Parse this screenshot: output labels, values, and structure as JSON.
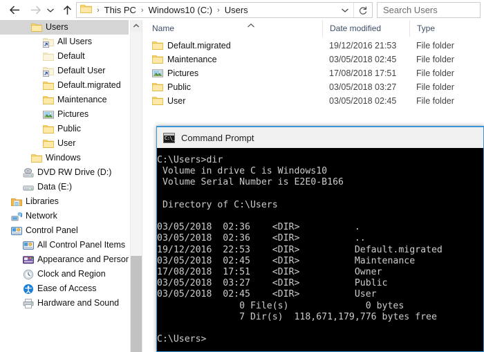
{
  "window": {
    "title": "This PC > Windows10 (C:) > Users"
  },
  "nav": {
    "back_label": "Back",
    "forward_label": "Forward",
    "recent_label": "Recent locations",
    "up_label": "Up one level",
    "breadcrumbs": [
      "This PC",
      "Windows10 (C:)",
      "Users"
    ],
    "separator": "›",
    "dropdown_label": "Previous locations",
    "refresh_label": "Refresh"
  },
  "search": {
    "placeholder": "Search Users"
  },
  "columns": [
    {
      "label": "Name",
      "sorted": true,
      "sort_direction": "ascending"
    },
    {
      "label": "Date modified",
      "sorted": false
    },
    {
      "label": "Type",
      "sorted": false
    }
  ],
  "files": [
    {
      "name": "Default.migrated",
      "date": "19/12/2016 21:53",
      "type": "File folder",
      "icon": "folder-icon"
    },
    {
      "name": "Maintenance",
      "date": "03/05/2018 02:45",
      "type": "File folder",
      "icon": "folder-icon"
    },
    {
      "name": "Pictures",
      "date": "17/08/2018 17:51",
      "type": "File folder",
      "icon": "pictures-folder-icon"
    },
    {
      "name": "Public",
      "date": "03/05/2018 03:27",
      "type": "File folder",
      "icon": "folder-icon"
    },
    {
      "name": "User",
      "date": "03/05/2018 02:45",
      "type": "File folder",
      "icon": "folder-icon"
    }
  ],
  "sidebar": {
    "items": [
      {
        "label": "Users",
        "icon": "folder-icon",
        "indent": 45,
        "selected": true
      },
      {
        "label": "All Users",
        "icon": "shortcut-folder-icon",
        "indent": 62,
        "selected": false
      },
      {
        "label": "Default",
        "icon": "faded-folder-icon",
        "indent": 62,
        "selected": false
      },
      {
        "label": "Default User",
        "icon": "shortcut-folder-icon",
        "indent": 62,
        "selected": false
      },
      {
        "label": "Default.migrated",
        "icon": "folder-icon",
        "indent": 62,
        "selected": false
      },
      {
        "label": "Maintenance",
        "icon": "folder-icon",
        "indent": 62,
        "selected": false
      },
      {
        "label": "Pictures",
        "icon": "pictures-folder-icon",
        "indent": 62,
        "selected": false
      },
      {
        "label": "Public",
        "icon": "folder-icon",
        "indent": 62,
        "selected": false
      },
      {
        "label": "User",
        "icon": "folder-icon",
        "indent": 62,
        "selected": false
      },
      {
        "label": "Windows",
        "icon": "folder-icon",
        "indent": 45,
        "selected": false
      },
      {
        "label": "DVD RW Drive (D:)",
        "icon": "dvd-drive-icon",
        "indent": 33,
        "selected": false
      },
      {
        "label": "Data (E:)",
        "icon": "hard-drive-icon",
        "indent": 33,
        "selected": false
      },
      {
        "label": "Libraries",
        "icon": "libraries-icon",
        "indent": 16,
        "selected": false
      },
      {
        "label": "Network",
        "icon": "network-icon",
        "indent": 16,
        "selected": false
      },
      {
        "label": "Control Panel",
        "icon": "control-panel-icon",
        "indent": 16,
        "selected": false
      },
      {
        "label": "All Control Panel Items",
        "icon": "control-panel-icon",
        "indent": 33,
        "selected": false
      },
      {
        "label": "Appearance and Personalization",
        "icon": "appearance-icon",
        "indent": 33,
        "selected": false
      },
      {
        "label": "Clock and Region",
        "icon": "clock-icon",
        "indent": 33,
        "selected": false
      },
      {
        "label": "Ease of Access",
        "icon": "ease-of-access-icon",
        "indent": 33,
        "selected": false
      },
      {
        "label": "Hardware and Sound",
        "icon": "printer-icon",
        "indent": 33,
        "selected": false
      }
    ]
  },
  "command_prompt": {
    "title": "Command Prompt",
    "icon": "console-icon",
    "console_text": "C:\\Users>dir\n Volume in drive C is Windows10\n Volume Serial Number is E2E0-B166\n\n Directory of C:\\Users\n\n03/05/2018  02:36    <DIR>          .\n03/05/2018  02:36    <DIR>          ..\n19/12/2016  22:53    <DIR>          Default.migrated\n03/05/2018  02:45    <DIR>          Maintenance\n17/08/2018  17:51    <DIR>          Owner\n03/05/2018  03:27    <DIR>          Public\n03/05/2018  02:45    <DIR>          User\n               0 File(s)              0 bytes\n               7 Dir(s)  118,671,179,776 bytes free\n\nC:\\Users>"
  },
  "colors": {
    "folder_yellow": "#ffd75e",
    "selection_gray": "#d5d5d5",
    "header_blue": "#3d4f66",
    "window_border_blue": "#3b96d8",
    "console_bg": "#000000",
    "console_fg": "#cccccc"
  }
}
